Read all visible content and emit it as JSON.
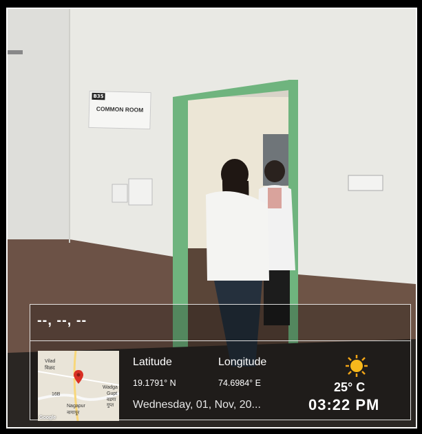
{
  "sign": {
    "room_no": "B35",
    "label": "COMMON ROOM"
  },
  "overlay": {
    "address": "--, --, --",
    "latitude_label": "Latitude",
    "latitude_value": "19.1791° N",
    "longitude_label": "Longitude",
    "longitude_value": "74.6984° E",
    "date": "Wednesday, 01, Nov, 20...",
    "temperature": "25° C",
    "time": "03:22 PM",
    "weather_icon": "sun-icon"
  },
  "map": {
    "places": [
      "Vilad",
      "विळद",
      "Wadga",
      "Gupt",
      "वडगा",
      "गुप्त",
      "Nagapur",
      "नागापूर",
      "16B"
    ],
    "logo": "Google",
    "pin_color": "#d93025"
  },
  "colors": {
    "door_frame": "#6fb47e",
    "wall": "#ebebe6",
    "dado": "#6e5446"
  }
}
